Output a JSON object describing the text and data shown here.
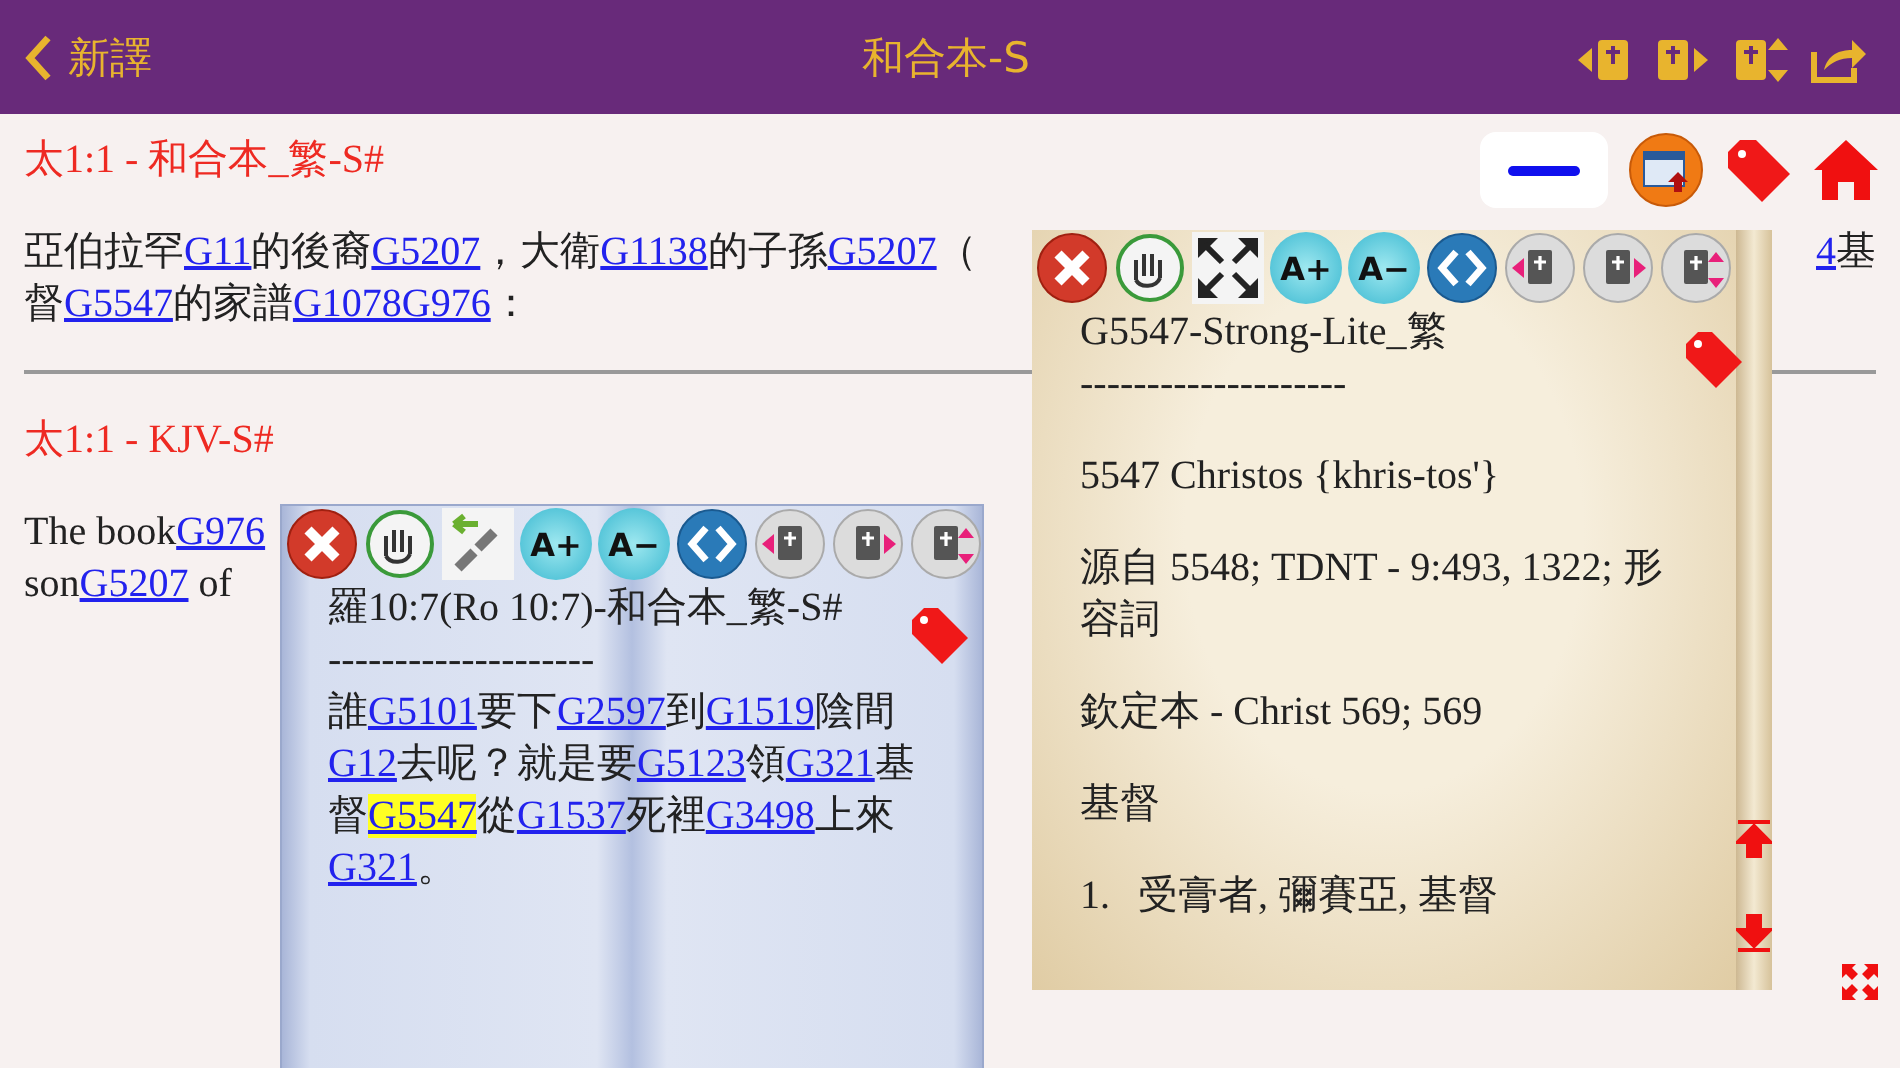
{
  "header": {
    "back_label": "新譯",
    "title": "和合本-S",
    "actions": [
      {
        "kind": "book_prev"
      },
      {
        "kind": "book_next"
      },
      {
        "kind": "book_updown"
      },
      {
        "kind": "share"
      }
    ]
  },
  "side_actions": [
    {
      "kind": "minimize"
    },
    {
      "kind": "window"
    },
    {
      "kind": "tag"
    },
    {
      "kind": "home"
    }
  ],
  "verses": [
    {
      "heading": "太1:1 - 和合本_繁-S#",
      "lines": [
        [
          [
            {
              "kind": "text",
              "text": "亞伯拉罕"
            },
            {
              "kind": "link",
              "text": "G11"
            },
            {
              "kind": "text",
              "text": "的後裔"
            },
            {
              "kind": "link",
              "text": "G5207"
            },
            {
              "kind": "text",
              "text": "，大衛"
            },
            {
              "kind": "link",
              "text": "G1138"
            },
            {
              "kind": "text",
              "text": "的子孫"
            },
            {
              "kind": "link",
              "text": "G5207"
            },
            {
              "kind": "text",
              "text": "（"
            }
          ],
          [
            {
              "kind": "link",
              "text": "4"
            },
            {
              "kind": "text",
              "text": "基"
            }
          ]
        ],
        [
          [
            {
              "kind": "text",
              "text": "督"
            },
            {
              "kind": "link",
              "text": "G5547"
            },
            {
              "kind": "text",
              "text": "的家譜"
            },
            {
              "kind": "link",
              "text": "G1078G976"
            },
            {
              "kind": "text",
              "text": "："
            }
          ]
        ]
      ]
    },
    {
      "heading": "太1:1 - KJV-S#",
      "lines": [
        [
          [
            {
              "kind": "text",
              "text": "The book"
            },
            {
              "kind": "link",
              "text": "G976"
            }
          ]
        ],
        [
          [
            {
              "kind": "text",
              "text": "son"
            },
            {
              "kind": "link",
              "text": "G5207"
            },
            {
              "kind": "text",
              "text": " of"
            }
          ]
        ]
      ]
    }
  ],
  "left_popup": {
    "toolbar": [
      {
        "kind": "close"
      },
      {
        "kind": "hand"
      },
      {
        "kind": "link"
      },
      {
        "kind": "font_up",
        "label": "A+"
      },
      {
        "kind": "font_down",
        "label": "A−"
      },
      {
        "kind": "code"
      },
      {
        "kind": "book_prev"
      },
      {
        "kind": "book_next"
      },
      {
        "kind": "book_updown"
      }
    ],
    "title": "羅10:7(Ro 10:7)-和合本_繁-S#",
    "divider": "--------------------",
    "text": [
      {
        "kind": "text",
        "text": "誰"
      },
      {
        "kind": "link",
        "text": "G5101",
        "highlighted": false
      },
      {
        "kind": "text",
        "text": "要下"
      },
      {
        "kind": "link",
        "text": "G2597",
        "highlighted": false
      },
      {
        "kind": "text",
        "text": "到"
      },
      {
        "kind": "link",
        "text": "G1519",
        "highlighted": false
      },
      {
        "kind": "text",
        "text": "陰間"
      },
      {
        "kind": "link",
        "text": "G12",
        "highlighted": false
      },
      {
        "kind": "text",
        "text": "去呢？就是要"
      },
      {
        "kind": "link",
        "text": "G5123",
        "highlighted": false
      },
      {
        "kind": "text",
        "text": "領"
      },
      {
        "kind": "link",
        "text": "G321",
        "highlighted": false
      },
      {
        "kind": "text",
        "text": "基督"
      },
      {
        "kind": "link",
        "text": "G5547",
        "highlighted": true
      },
      {
        "kind": "text",
        "text": "從"
      },
      {
        "kind": "link",
        "text": "G1537",
        "highlighted": false
      },
      {
        "kind": "text",
        "text": "死裡"
      },
      {
        "kind": "link",
        "text": "G3498",
        "highlighted": false
      },
      {
        "kind": "text",
        "text": "上來"
      },
      {
        "kind": "link",
        "text": "G321",
        "highlighted": false
      },
      {
        "kind": "text",
        "text": "。"
      }
    ]
  },
  "right_popup": {
    "toolbar": [
      {
        "kind": "close"
      },
      {
        "kind": "hand"
      },
      {
        "kind": "expand"
      },
      {
        "kind": "font_up",
        "label": "A+"
      },
      {
        "kind": "font_down",
        "label": "A−"
      },
      {
        "kind": "code"
      },
      {
        "kind": "book_prev"
      },
      {
        "kind": "book_next"
      },
      {
        "kind": "book_updown"
      }
    ],
    "title": "G5547-Strong-Lite_繁",
    "divider": "--------------------",
    "paragraphs": [
      "5547 Christos {khris-tos'}",
      "源自 5548; TDNT - 9:493, 1322; 形容詞",
      "欽定本 - Christ 569; 569",
      "基督"
    ],
    "list": [
      {
        "number": "1.",
        "text": "受膏者, 彌賽亞, 基督"
      }
    ],
    "scroll_controls": [
      {
        "kind": "to_top"
      },
      {
        "kind": "to_bottom"
      }
    ]
  },
  "corner_actions": [
    {
      "kind": "fullscreen"
    }
  ]
}
